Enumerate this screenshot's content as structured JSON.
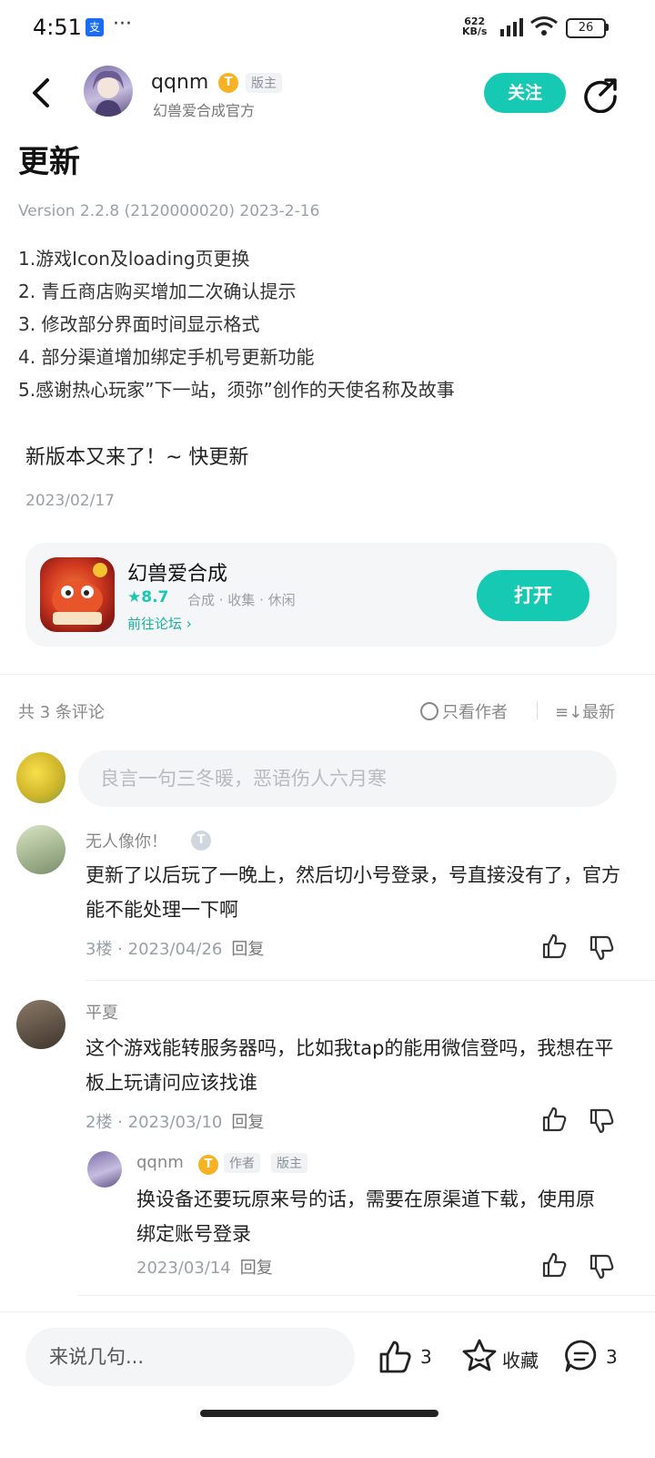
{
  "status": {
    "time": "4:51",
    "speed_top": "622",
    "speed_bottom": "KB/s",
    "battery": "26"
  },
  "header": {
    "user": "qqnm",
    "level_badge": "T",
    "role_tag": "版主",
    "subtitle": "幻兽爱合成官方",
    "follow_label": "关注"
  },
  "post": {
    "title": "更新",
    "version": "Version 2.2.8 (2120000020) 2023-2-16",
    "notes": [
      "1.游戏Icon及loading页更换",
      "2. 青丘商店购买增加二次确认提示",
      "3. 修改部分界面时间显示格式",
      "4. 部分渠道增加绑定手机号更新功能",
      "5.感谢热心玩家”下一站，须弥”创作的天使名称及故事"
    ],
    "body": "新版本又来了！~ 快更新",
    "date": "2023/02/17"
  },
  "game": {
    "name": "幻兽爱合成",
    "rating": "8.7",
    "tags": "合成 · 收集 · 休闲",
    "forum_link": "前往论坛",
    "open_label": "打开"
  },
  "comments_header": {
    "count": "共 3 条评论",
    "author_only": "只看作者",
    "sort": "最新"
  },
  "comment_input": {
    "placeholder": "良言一句三冬暖，恶语伤人六月寒"
  },
  "comments": [
    {
      "name": "无人像你！",
      "text": "更新了以后玩了一晚上，然后切小号登录，号直接没有了，官方能不能处理一下啊",
      "floor": "3楼",
      "date": "2023/04/26",
      "reply": "回复"
    },
    {
      "name": "平夏",
      "text": "这个游戏能转服务器吗，比如我tap的能用微信登吗，我想在平板上玩请问应该找谁",
      "floor": "2楼",
      "date": "2023/03/10",
      "reply": "回复",
      "sub": {
        "name": "qqnm",
        "author_tag": "作者",
        "role_tag": "版主",
        "text": "换设备还要玩原来号的话，需要在原渠道下载，使用原绑定账号登录",
        "date": "2023/03/14",
        "reply": "回复"
      }
    }
  ],
  "bottom": {
    "placeholder": "来说几句...",
    "like_count": "3",
    "fav_label": "收藏",
    "comment_count": "3"
  }
}
